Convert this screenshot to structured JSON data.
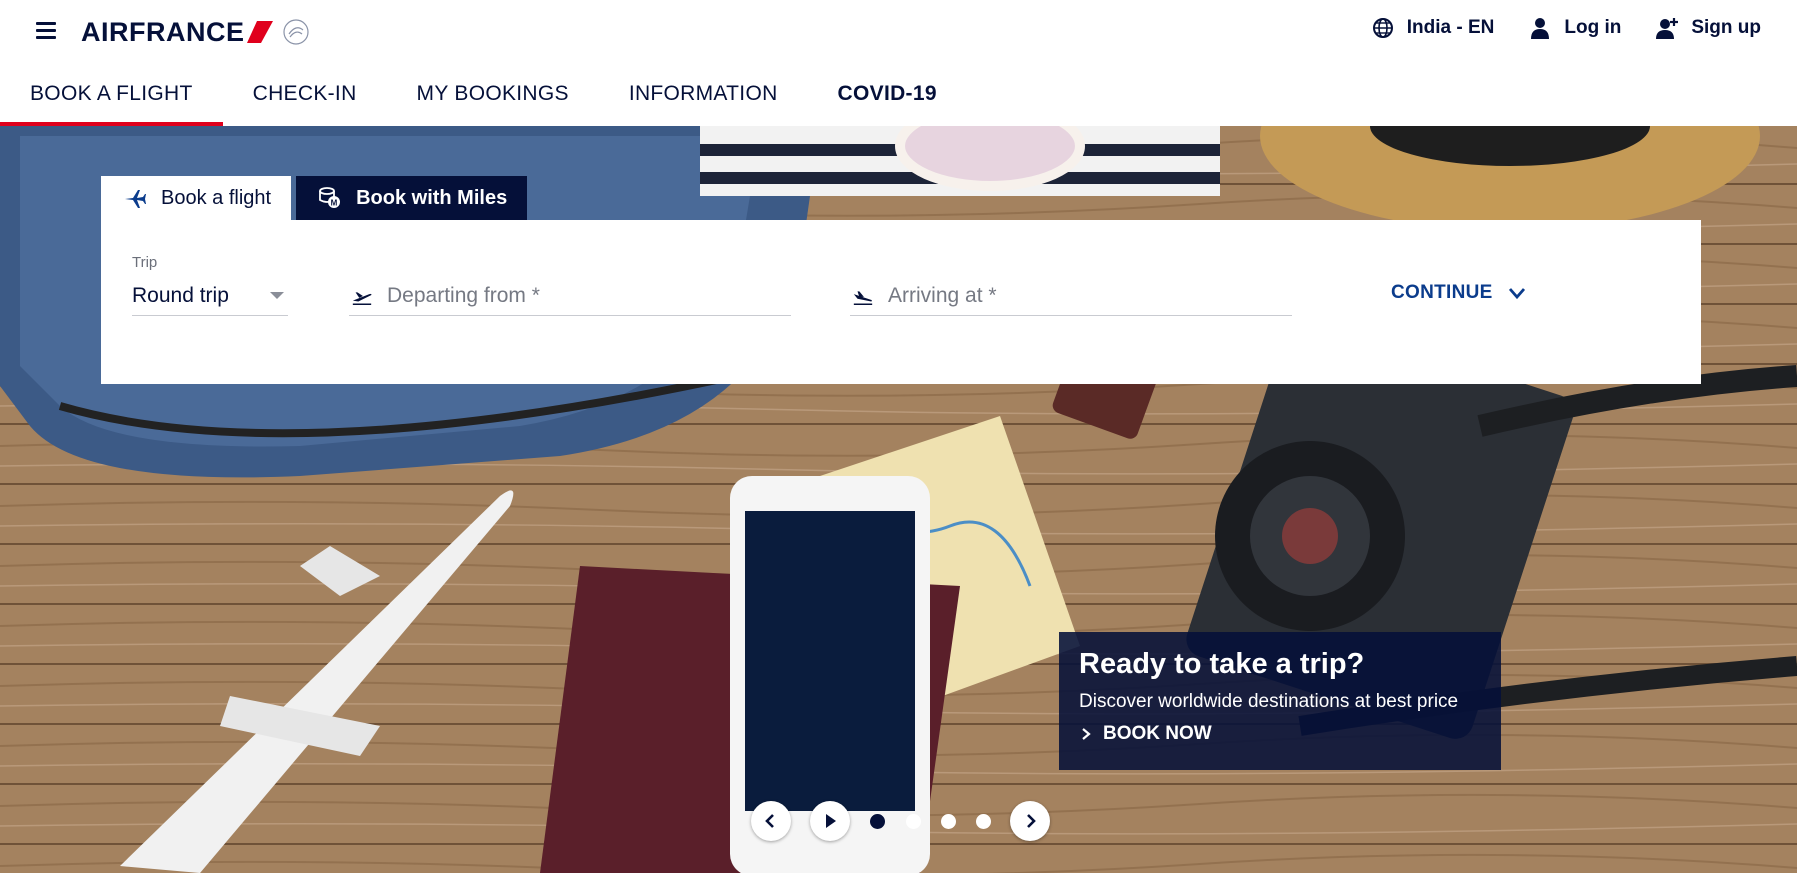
{
  "header": {
    "logo_text": "AIRFRANCE",
    "logo_badge": "SKYTEAM",
    "locale": "India - EN",
    "login": "Log in",
    "signup": "Sign up"
  },
  "nav": {
    "tabs": [
      {
        "label": "BOOK A FLIGHT",
        "active": true
      },
      {
        "label": "CHECK-IN",
        "active": false
      },
      {
        "label": "MY BOOKINGS",
        "active": false
      },
      {
        "label": "INFORMATION",
        "active": false
      },
      {
        "label": "COVID-19",
        "active": false
      }
    ]
  },
  "booking": {
    "tabs": [
      {
        "label": "Book a flight",
        "icon": "airplane-icon",
        "active": true
      },
      {
        "label": "Book with Miles",
        "icon": "miles-coins-icon",
        "active": false
      }
    ],
    "trip_label": "Trip",
    "trip_value": "Round trip",
    "departing_placeholder": "Departing from *",
    "arriving_placeholder": "Arriving at *",
    "continue_label": "CONTINUE"
  },
  "promo": {
    "title": "Ready to take a trip?",
    "subtitle": "Discover worldwide destinations at best price",
    "cta": "BOOK NOW"
  },
  "carousel": {
    "slide_count": 4,
    "active_slide": 1,
    "controls": [
      "prev",
      "play",
      "next"
    ]
  },
  "colors": {
    "brand_navy": "#051039",
    "brand_red": "#e0001c",
    "link_blue": "#0b3c8c",
    "white": "#ffffff"
  }
}
